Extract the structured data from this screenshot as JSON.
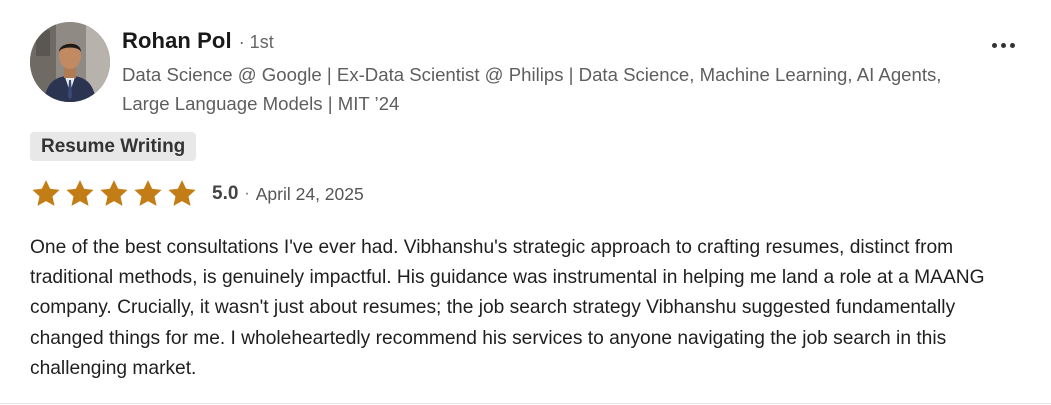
{
  "review": {
    "author": {
      "name": "Rohan Pol",
      "connection": "· 1st",
      "headline": "Data Science @ Google | Ex-Data Scientist @ Philips | Data Science, Machine Learning, AI Agents, Large Language Models | MIT ’24",
      "avatar_icon": "profile-photo"
    },
    "more_icon": "more-horizontal-icon",
    "tag": "Resume Writing",
    "rating": {
      "value": "5.0",
      "stars_filled": 5,
      "stars_total": 5,
      "star_color": "#C37D16",
      "separator": "·",
      "date": "April 24, 2025"
    },
    "text": "One of the best consultations I've ever had. Vibhanshu's strategic approach to crafting resumes, distinct from traditional methods, is genuinely impactful. His guidance was instrumental in helping me land a role at a MAANG company. Crucially, it wasn't just about resumes; the job search strategy Vibhanshu suggested fundamentally changed things for me. I wholeheartedly recommend his services to anyone navigating the job search in this challenging market."
  }
}
